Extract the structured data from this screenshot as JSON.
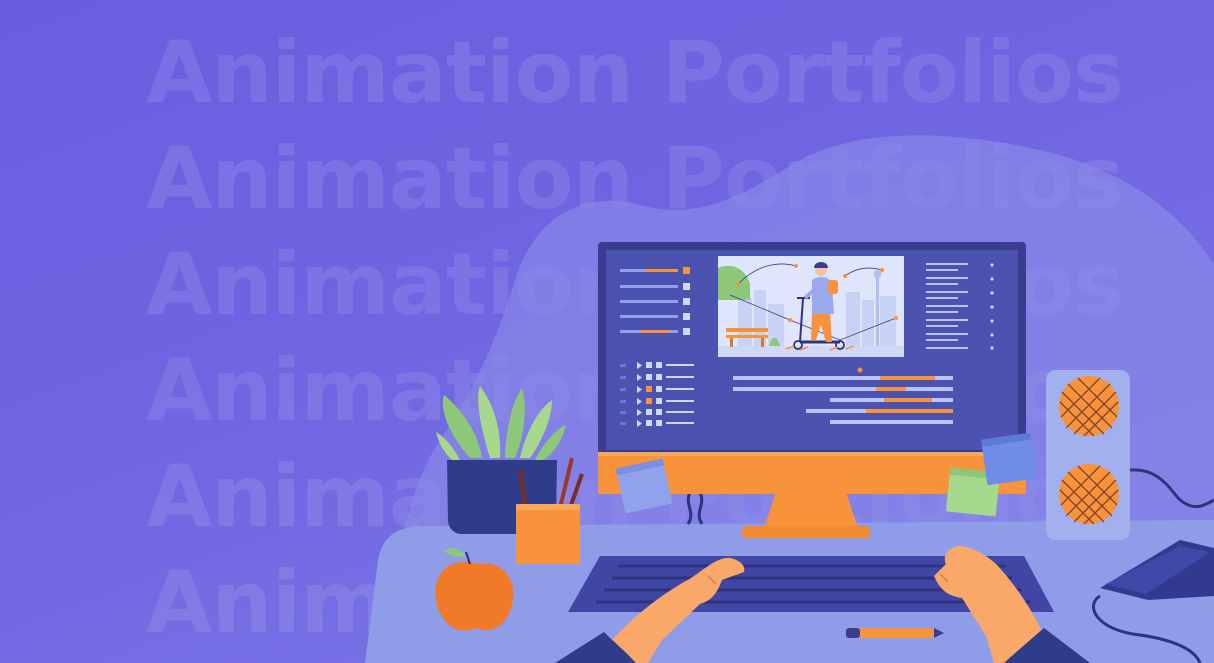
{
  "banner": {
    "background_lines": [
      "Animation Portfolios",
      "Animation Portfolios",
      "Animation Portfolios",
      "Animation Portfolios",
      "Animation Portfolios",
      "Animation Portfolios"
    ]
  },
  "colors": {
    "background": "#6a5ee0",
    "blob": "#8a8ae8",
    "monitor_frame": "#3a3d8f",
    "monitor_screen": "#4b52b0",
    "accent_orange": "#f6933b",
    "desk": "#8f9ce8",
    "keyboard": "#3f46a3",
    "plant": "#8cc77a"
  },
  "icons": [
    "monitor-illustration",
    "animation-editor-screen",
    "person-on-scooter-icon",
    "houseplant-icon",
    "pencil-cup-icon",
    "apple-icon",
    "keyboard-icon",
    "hands-icon",
    "speaker-icon",
    "tablet-icon",
    "sticky-note-icon",
    "pen-icon"
  ]
}
